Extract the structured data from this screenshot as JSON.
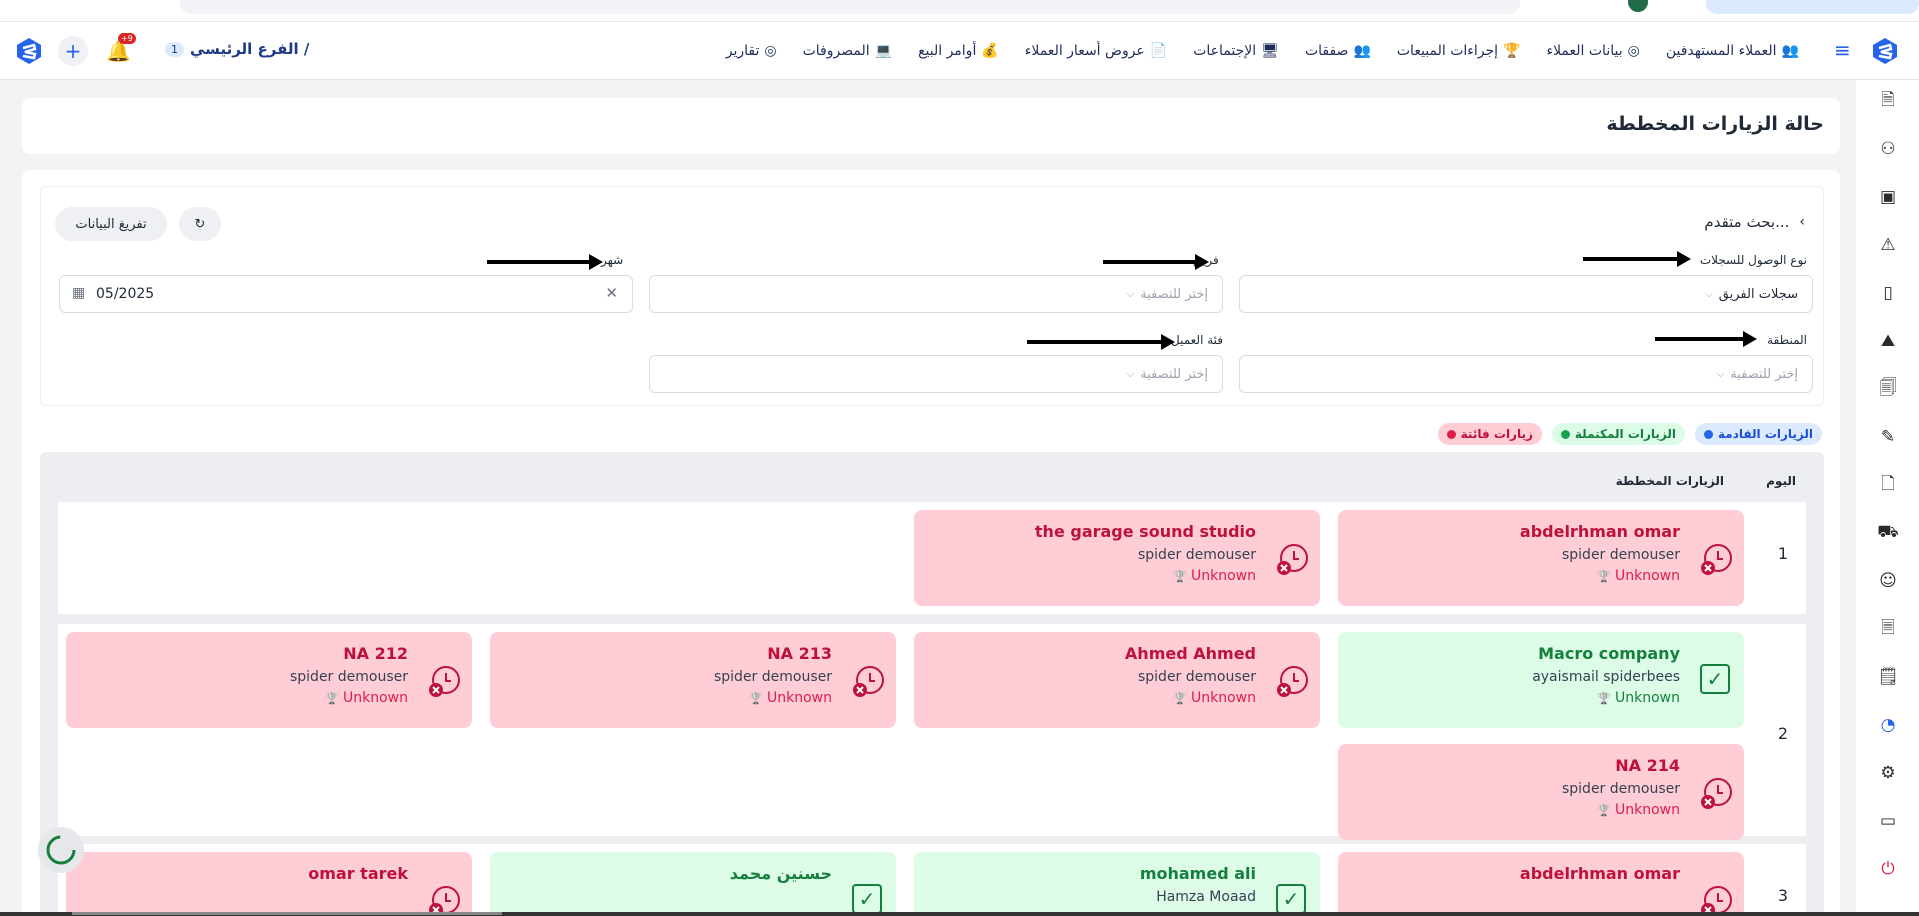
{
  "nav": {
    "items": [
      {
        "label": "العملاء المستهدفين",
        "icon": "target-clients-icon",
        "glyph": "👥"
      },
      {
        "label": "بيانات العملاء",
        "icon": "client-data-icon",
        "glyph": "◎"
      },
      {
        "label": "إجراءات المبيعات",
        "icon": "sales-actions-icon",
        "glyph": "🏆"
      },
      {
        "label": "صفقات",
        "icon": "deals-icon",
        "glyph": "👥"
      },
      {
        "label": "الإجتماعات",
        "icon": "meetings-icon",
        "glyph": "🖥"
      },
      {
        "label": "عروض أسعار العملاء",
        "icon": "quotes-icon",
        "glyph": "📄"
      },
      {
        "label": "أوامر البيع",
        "icon": "sales-orders-icon",
        "glyph": "💰"
      },
      {
        "label": "المصروفات",
        "icon": "expenses-icon",
        "glyph": "💻"
      },
      {
        "label": "تقارير",
        "icon": "reports-icon",
        "glyph": "◎"
      }
    ],
    "branch_label": "الفرع الرئيسي /",
    "branch_num": "1",
    "notif_badge": "+9"
  },
  "page": {
    "title": "حالة الزيارات المخططة"
  },
  "filters": {
    "advanced": "بحث متقدم...",
    "clear_button": "تفريغ البيانات",
    "access_label": "نوع الوصول للسجلات",
    "access_value": "سجلات الفريق",
    "team_label": "فريق",
    "team_placeholder": "إختر للتصفية",
    "month_label": "شهر",
    "month_value": "05/2025",
    "region_label": "المنطقة",
    "region_placeholder": "إختر للتصفية",
    "category_label": "فئة العميل",
    "category_placeholder": "إختر للتصفية"
  },
  "legend": [
    {
      "label": "الزيارات القادمة",
      "color": "#2563eb",
      "bg": "#dbeafe",
      "text": "#1d4ed8"
    },
    {
      "label": "الزيارات المكتملة",
      "color": "#16a34a",
      "bg": "#dcfce7",
      "text": "#15803d"
    },
    {
      "label": "زيارات فائتة",
      "color": "#e11d48",
      "bg": "#fecdd6",
      "text": "#be123c"
    }
  ],
  "table": {
    "col_day": "اليوم",
    "col_visits": "الزيارات المخططة",
    "rows": [
      {
        "day": "1",
        "visits": [
          {
            "name": "abdelrhman omar",
            "employee": "spider demouser",
            "category": "Unknown",
            "status": "missed"
          },
          {
            "name": "the garage sound studio",
            "employee": "spider demouser",
            "category": "Unknown",
            "status": "missed"
          }
        ]
      },
      {
        "day": "2",
        "visits": [
          {
            "name": "Macro company",
            "employee": "ayaismail spiderbees",
            "category": "Unknown",
            "status": "completed"
          },
          {
            "name": "Ahmed Ahmed",
            "employee": "spider demouser",
            "category": "Unknown",
            "status": "missed"
          },
          {
            "name": "NA 213",
            "employee": "spider demouser",
            "category": "Unknown",
            "status": "missed"
          },
          {
            "name": "NA 212",
            "employee": "spider demouser",
            "category": "Unknown",
            "status": "missed"
          },
          {
            "name": "NA 214",
            "employee": "spider demouser",
            "category": "Unknown",
            "status": "missed"
          }
        ]
      },
      {
        "day": "3",
        "visits": [
          {
            "name": "abdelrhman omar",
            "employee": "",
            "category": "",
            "status": "missed"
          },
          {
            "name": "mohamed ali",
            "employee": "Hamza Moaad",
            "category": "",
            "status": "completed"
          },
          {
            "name": "حسنين محمد",
            "employee": "",
            "category": "",
            "status": "completed"
          },
          {
            "name": "omar tarek",
            "employee": "",
            "category": "",
            "status": "missed"
          }
        ]
      }
    ]
  },
  "colors": {
    "accent": "#2563eb",
    "missed": "#e11d48",
    "completed": "#15803d"
  }
}
